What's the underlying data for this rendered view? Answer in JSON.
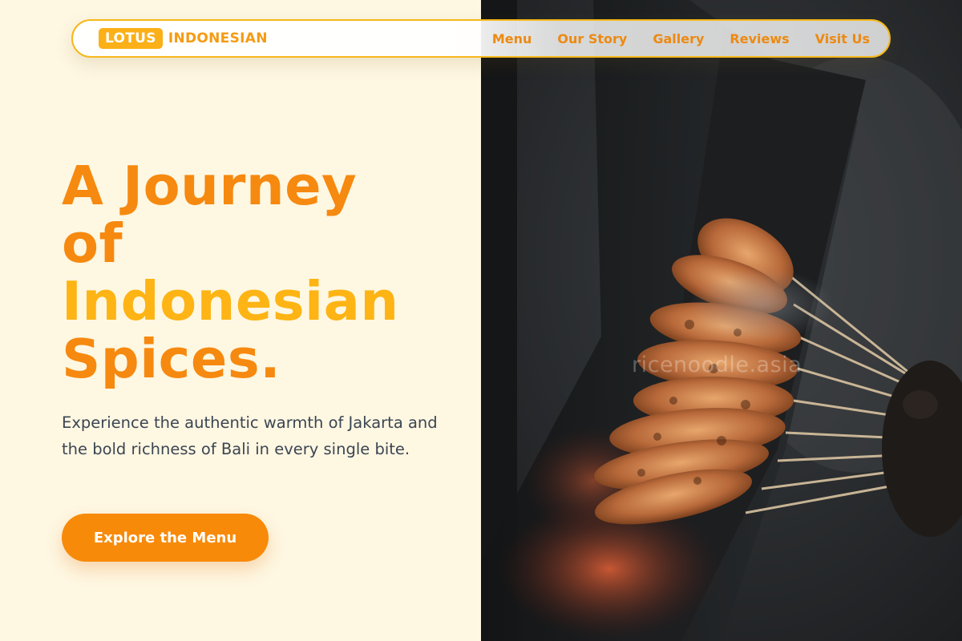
{
  "brand": {
    "badge": "LOTUS",
    "name": "INDONESIAN"
  },
  "nav": {
    "items": [
      "Menu",
      "Our Story",
      "Gallery",
      "Reviews",
      "Visit Us"
    ]
  },
  "hero": {
    "title_lines": [
      "A Journey",
      "of",
      "Indonesian",
      "Spices."
    ],
    "subtitle": "Experience the authentic warmth of Jakarta and the bold richness of Bali in every single bite.",
    "cta_label": "Explore the Menu"
  },
  "photo": {
    "watermark": "ricenoodle.asia"
  },
  "colors": {
    "primary": "#f6890f",
    "accent": "#fdb414",
    "background": "#fef7e2",
    "text": "#3b4552"
  }
}
